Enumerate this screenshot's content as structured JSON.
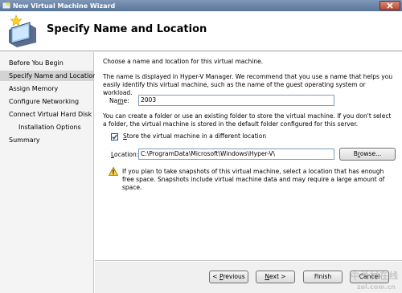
{
  "window": {
    "title": "New Virtual Machine Wizard",
    "header_title": "Specify Name and Location"
  },
  "nav": {
    "items": [
      {
        "label": "Before You Begin",
        "selected": false,
        "sub": false
      },
      {
        "label": "Specify Name and Location",
        "selected": true,
        "sub": false
      },
      {
        "label": "Assign Memory",
        "selected": false,
        "sub": false
      },
      {
        "label": "Configure Networking",
        "selected": false,
        "sub": false
      },
      {
        "label": "Connect Virtual Hard Disk",
        "selected": false,
        "sub": false
      },
      {
        "label": "Installation Options",
        "selected": false,
        "sub": true
      },
      {
        "label": "Summary",
        "selected": false,
        "sub": false
      }
    ]
  },
  "content": {
    "intro": "Choose a name and location for this virtual machine.",
    "name_help": "The name is displayed in Hyper-V Manager. We recommend that you use a name that helps you easily identify this virtual machine, such as the name of the guest operating system or workload.",
    "name_label_pre": "Na",
    "name_label_ul": "m",
    "name_label_post": "e:",
    "name_value": "2003",
    "folder_help": "You can create a folder or use an existing folder to store the virtual machine. If you don't select a folder, the virtual machine is stored in the default folder configured for this server.",
    "store_checkbox_ul": "S",
    "store_checkbox_rest": "tore the virtual machine in a different location",
    "store_checked": true,
    "location_label_pre": "",
    "location_label_ul": "L",
    "location_label_post": "ocation:",
    "location_value": "C:\\ProgramData\\Microsoft\\Windows\\Hyper-V\\",
    "browse_label_pre": "B",
    "browse_label_ul": "r",
    "browse_label_post": "owse...",
    "warning": "If you plan to take snapshots of this virtual machine, select a location that has enough free space. Snapshots include virtual machine data and may require a large amount of space."
  },
  "buttons": {
    "previous_pre": "< ",
    "previous_ul": "P",
    "previous_post": "revious",
    "next_ul": "N",
    "next_post": "ext >",
    "finish": "Finish",
    "cancel": "Cancel"
  },
  "watermark": {
    "line1": "中关村在线",
    "line2": "zol.com.cn"
  }
}
